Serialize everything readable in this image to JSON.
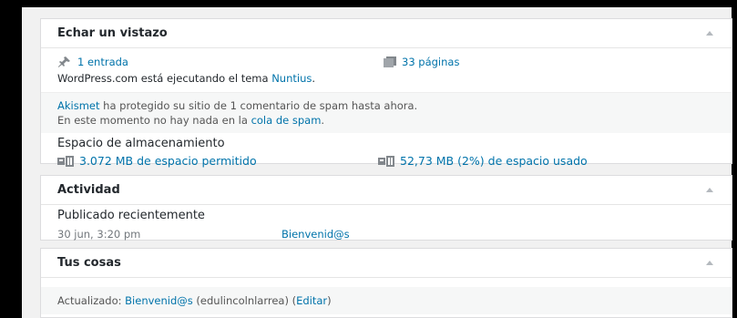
{
  "glance": {
    "title": "Echar un vistazo",
    "posts": "1 entrada",
    "pages": "33 páginas",
    "theme_prefix": "WordPress.com está ejecutando el tema ",
    "theme_name": "Nuntius",
    "theme_suffix": ".",
    "akismet_link": "Akismet",
    "akismet_text": " ha protegido su sitio de 1 comentario de spam hasta ahora.",
    "akismet_line2_prefix": "En este momento no hay nada en la ",
    "akismet_queue_link": "cola de spam",
    "akismet_line2_suffix": ".",
    "storage_title": "Espacio de almacenamiento",
    "storage_allowed": "3.072 MB de espacio permitido",
    "storage_used": "52,73 MB (2%) de espacio usado"
  },
  "activity": {
    "title": "Actividad",
    "subtitle": "Publicado recientemente",
    "date": "30 jun, 3:20 pm",
    "post": "Bienvenid@s"
  },
  "stuff": {
    "title": "Tus cosas",
    "prefix": "Actualizado: ",
    "post": "Bienvenid@s",
    "middle": " (edulincolnlarrea) (",
    "edit": "Editar",
    "suffix": ")"
  },
  "colors": {
    "link": "#0073aa",
    "text": "#23282d",
    "muted": "#72777c",
    "icon": "#82878c"
  },
  "icons": [
    "pin-icon",
    "pages-icon",
    "storage-icon",
    "collapse-icon"
  ]
}
